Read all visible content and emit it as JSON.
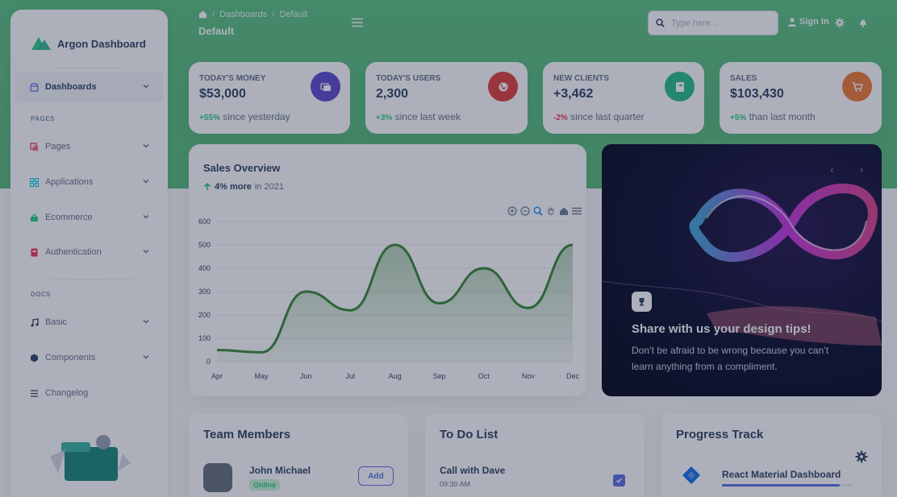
{
  "brand": {
    "name": "Argon Dashboard"
  },
  "sidebar": {
    "items": [
      {
        "label": "Dashboards",
        "icon": "shop-icon",
        "icon_color": "#5e72e4"
      },
      {
        "label": "Pages",
        "icon": "pages-icon",
        "icon_color": "#f5365c"
      },
      {
        "label": "Applications",
        "icon": "applications-icon",
        "icon_color": "#11cdef"
      },
      {
        "label": "Ecommerce",
        "icon": "basket-icon",
        "icon_color": "#2dce89"
      },
      {
        "label": "Authentication",
        "icon": "badge-icon",
        "icon_color": "#f5365c"
      },
      {
        "label": "Basic",
        "icon": "music-note-icon",
        "icon_color": "#344767"
      },
      {
        "label": "Components",
        "icon": "components-icon",
        "icon_color": "#344767"
      },
      {
        "label": "Changelog",
        "icon": "list-icon",
        "icon_color": "#344767"
      }
    ],
    "sections": {
      "pages": "PAGES",
      "docs": "DOCS"
    }
  },
  "header": {
    "breadcrumb": [
      "Dashboards",
      "Default"
    ],
    "title": "Default",
    "search_placeholder": "Type here...",
    "signin": "Sign In"
  },
  "stats": [
    {
      "label": "Today's Money",
      "value": "$53,000",
      "delta": "+55%",
      "delta_text": "since yesterday",
      "delta_color": "#2dce89",
      "badge_color": "#5e4fcf",
      "icon": "money-icon"
    },
    {
      "label": "Today's Users",
      "value": "2,300",
      "delta": "+3%",
      "delta_text": "since last week",
      "delta_color": "#2dce89",
      "badge_color": "#e0443f",
      "icon": "world-icon"
    },
    {
      "label": "New Clients",
      "value": "+3,462",
      "delta": "-2%",
      "delta_text": "since last quarter",
      "delta_color": "#f5365c",
      "badge_color": "#2dbf8f",
      "icon": "paper-icon"
    },
    {
      "label": "Sales",
      "value": "$103,430",
      "delta": "+5%",
      "delta_text": "than last month",
      "delta_color": "#2dce89",
      "badge_color": "#f07e3a",
      "icon": "cart-icon"
    }
  ],
  "sales_overview": {
    "title": "Sales Overview",
    "sub_bold": "4% more",
    "sub_text": "in 2021"
  },
  "chart_data": {
    "type": "area",
    "categories": [
      "Apr",
      "May",
      "Jun",
      "Jul",
      "Aug",
      "Sep",
      "Oct",
      "Nov",
      "Dec"
    ],
    "series": [
      {
        "values": [
          50,
          40,
          300,
          220,
          500,
          250,
          400,
          230,
          500
        ]
      }
    ],
    "ylim": [
      0,
      600
    ],
    "yticks": [
      0,
      100,
      200,
      300,
      400,
      500,
      600
    ],
    "grid": true,
    "color": "#3c8a3a"
  },
  "promo": {
    "title": "Share with us your design tips!",
    "text": "Don’t be afraid to be wrong because you can’t learn anything from a compliment."
  },
  "team": {
    "title": "Team Members",
    "member_name": "John Michael",
    "member_status": "Online",
    "add_label": "Add"
  },
  "todo": {
    "title": "To Do List",
    "item": "Call with Dave",
    "time": "09:30 AM"
  },
  "progress": {
    "title": "Progress Track",
    "project": "React Material Dashboard",
    "percent": 90
  }
}
